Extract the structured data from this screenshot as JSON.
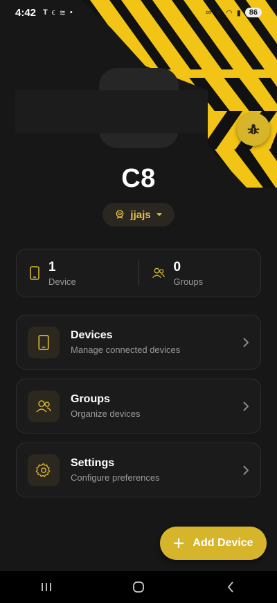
{
  "status": {
    "time": "4:42",
    "battery": "86"
  },
  "device": {
    "name": "C8",
    "user": "jjajs"
  },
  "stats": [
    {
      "count": "1",
      "label": "Device"
    },
    {
      "count": "0",
      "label": "Groups"
    }
  ],
  "menu": [
    {
      "title": "Devices",
      "subtitle": "Manage connected devices",
      "icon": "tablet-icon"
    },
    {
      "title": "Groups",
      "subtitle": "Organize devices",
      "icon": "users-icon"
    },
    {
      "title": "Settings",
      "subtitle": "Configure preferences",
      "icon": "gear-icon"
    }
  ],
  "fab": {
    "label": "Add Device"
  },
  "colors": {
    "accent": "#d6b52a",
    "accent_text": "#e4c44a",
    "background": "#171717",
    "card": "#1b1b1b"
  }
}
